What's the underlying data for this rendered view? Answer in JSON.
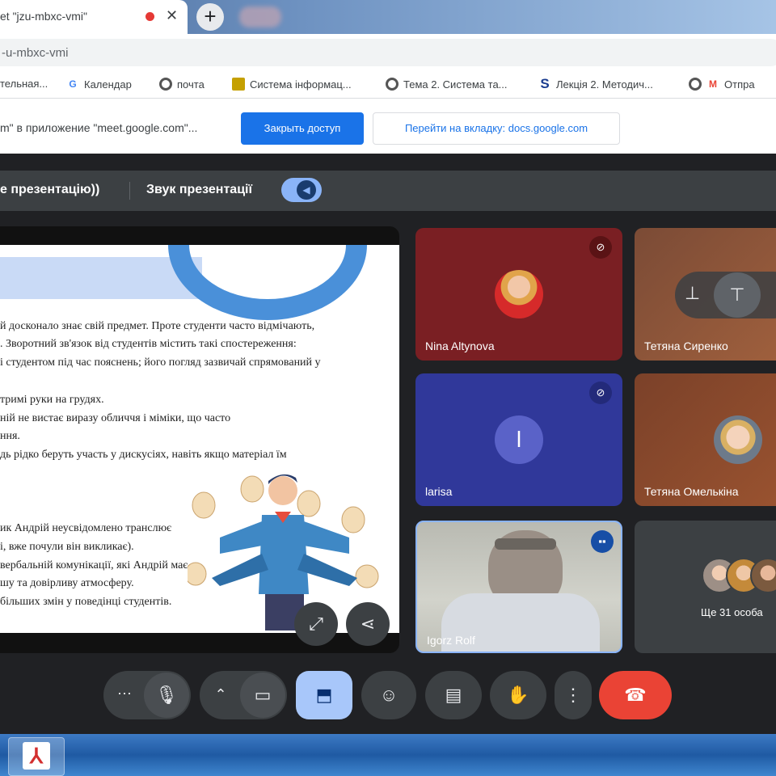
{
  "browser": {
    "tab_title": "et \"jzu-mbxc-vmi\"",
    "tab_close": "✕",
    "new_tab": "+",
    "address": "-u-mbxc-vmi",
    "bookmarks": [
      {
        "label": "тельная...",
        "icon": "bookmark-icon"
      },
      {
        "label": "Календар",
        "icon": "google-icon"
      },
      {
        "label": "почта",
        "icon": "globe-icon"
      },
      {
        "label": "Система інформац...",
        "icon": "site-icon"
      },
      {
        "label": "Тема 2. Система та...",
        "icon": "globe-icon"
      },
      {
        "label": "Лекція 2. Методич...",
        "icon": "s-icon"
      },
      {
        "label": "Отпра",
        "icon": "gmail-icon"
      }
    ]
  },
  "infobar": {
    "text": "m\" в приложение \"meet.google.com\"...",
    "stop_sharing": "Закрыть доступ",
    "go_to_tab": "Перейти на вкладку: docs.google.com"
  },
  "presentation_bar": {
    "stop_label": "е презентацію))",
    "audio_label": "Звук презентації",
    "audio_on": true
  },
  "slide": {
    "lines": [
      "й досконало знає свій предмет. Проте студенти часто відмічають,",
      ". Зворотний зв'язок від студентів містить такі спостереження:",
      "і студентом під час пояснень; його погляд зазвичай спрямований у",
      "",
      "тримі руки на грудях.",
      "ній не вистає виразу обличчя і міміки, що часто",
      "ння.",
      "дь рідко беруть участь у дискусіях, навіть якщо матеріал їм",
      "",
      "",
      "ик Андрій неусвідомлено транслює",
      "і, вже почули він викликає).",
      "вербальній комунікації, які Андрій має",
      "шу та довірливу атмосферу.",
      "більших змін у поведінці студентів."
    ]
  },
  "participants": [
    {
      "name": "Nina Altynova",
      "muted": true
    },
    {
      "name": "Тетяна Сиренко",
      "muted": false
    },
    {
      "name": "larisa",
      "initial": "l",
      "muted": true
    },
    {
      "name": "Тетяна Омелькіна",
      "muted": false
    },
    {
      "name": "Igorz Rolf",
      "speaking": true
    }
  ],
  "more_people": "Ще 31 особа",
  "controls": [
    "more",
    "mic",
    "camera",
    "present",
    "emoji",
    "captions",
    "raise-hand",
    "options",
    "leave"
  ],
  "colors": {
    "accent": "#8ab4f8",
    "leave": "#ea4335",
    "share": "#1a73e8"
  }
}
